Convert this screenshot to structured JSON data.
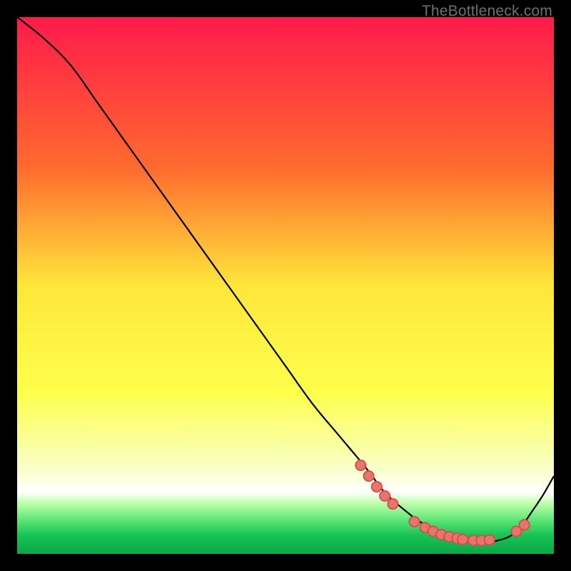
{
  "watermark": "TheBottleneck.com",
  "colors": {
    "top": "#ff1a4b",
    "mid_upper": "#ff9a2a",
    "mid": "#ffe63a",
    "mid_lower": "#f7ff66",
    "band_pale": "#f9ffc7",
    "green_top": "#c0ffad",
    "green_mid": "#62e877",
    "green_bottom": "#17c455",
    "curve": "#000000",
    "marker_fill": "#e9736d",
    "marker_stroke": "#d44f4c",
    "bg": "#000000"
  },
  "chart_data": {
    "type": "line",
    "title": "",
    "xlabel": "",
    "ylabel": "",
    "xlim": [
      0,
      100
    ],
    "ylim": [
      0,
      100
    ],
    "grid": false,
    "legend": false,
    "series": [
      {
        "name": "bottleneck-curve",
        "x": [
          0,
          5,
          10,
          15,
          20,
          25,
          30,
          35,
          40,
          45,
          50,
          55,
          60,
          65,
          68,
          70,
          73,
          75,
          78,
          80,
          82,
          84,
          86,
          88,
          90,
          92,
          94,
          96,
          98,
          100
        ],
        "y": [
          100,
          96,
          91,
          84,
          77,
          70,
          63,
          56,
          49,
          42,
          35,
          28,
          22,
          16,
          12,
          10,
          7.5,
          6,
          4.5,
          3.4,
          2.8,
          2.4,
          2.2,
          2.2,
          2.6,
          3.4,
          5.2,
          8,
          11,
          14.5
        ]
      }
    ],
    "markers": [
      {
        "x": 64.0,
        "y": 16.5
      },
      {
        "x": 65.5,
        "y": 14.5
      },
      {
        "x": 67.0,
        "y": 12.5
      },
      {
        "x": 68.5,
        "y": 10.8
      },
      {
        "x": 70.0,
        "y": 9.3
      },
      {
        "x": 74.0,
        "y": 6.0
      },
      {
        "x": 76.0,
        "y": 4.9
      },
      {
        "x": 77.5,
        "y": 4.2
      },
      {
        "x": 79.0,
        "y": 3.6
      },
      {
        "x": 80.5,
        "y": 3.2
      },
      {
        "x": 82.0,
        "y": 2.9
      },
      {
        "x": 83.0,
        "y": 2.7
      },
      {
        "x": 85.0,
        "y": 2.5
      },
      {
        "x": 86.5,
        "y": 2.5
      },
      {
        "x": 88.0,
        "y": 2.6
      },
      {
        "x": 93.0,
        "y": 4.2
      },
      {
        "x": 94.5,
        "y": 5.4
      }
    ]
  }
}
